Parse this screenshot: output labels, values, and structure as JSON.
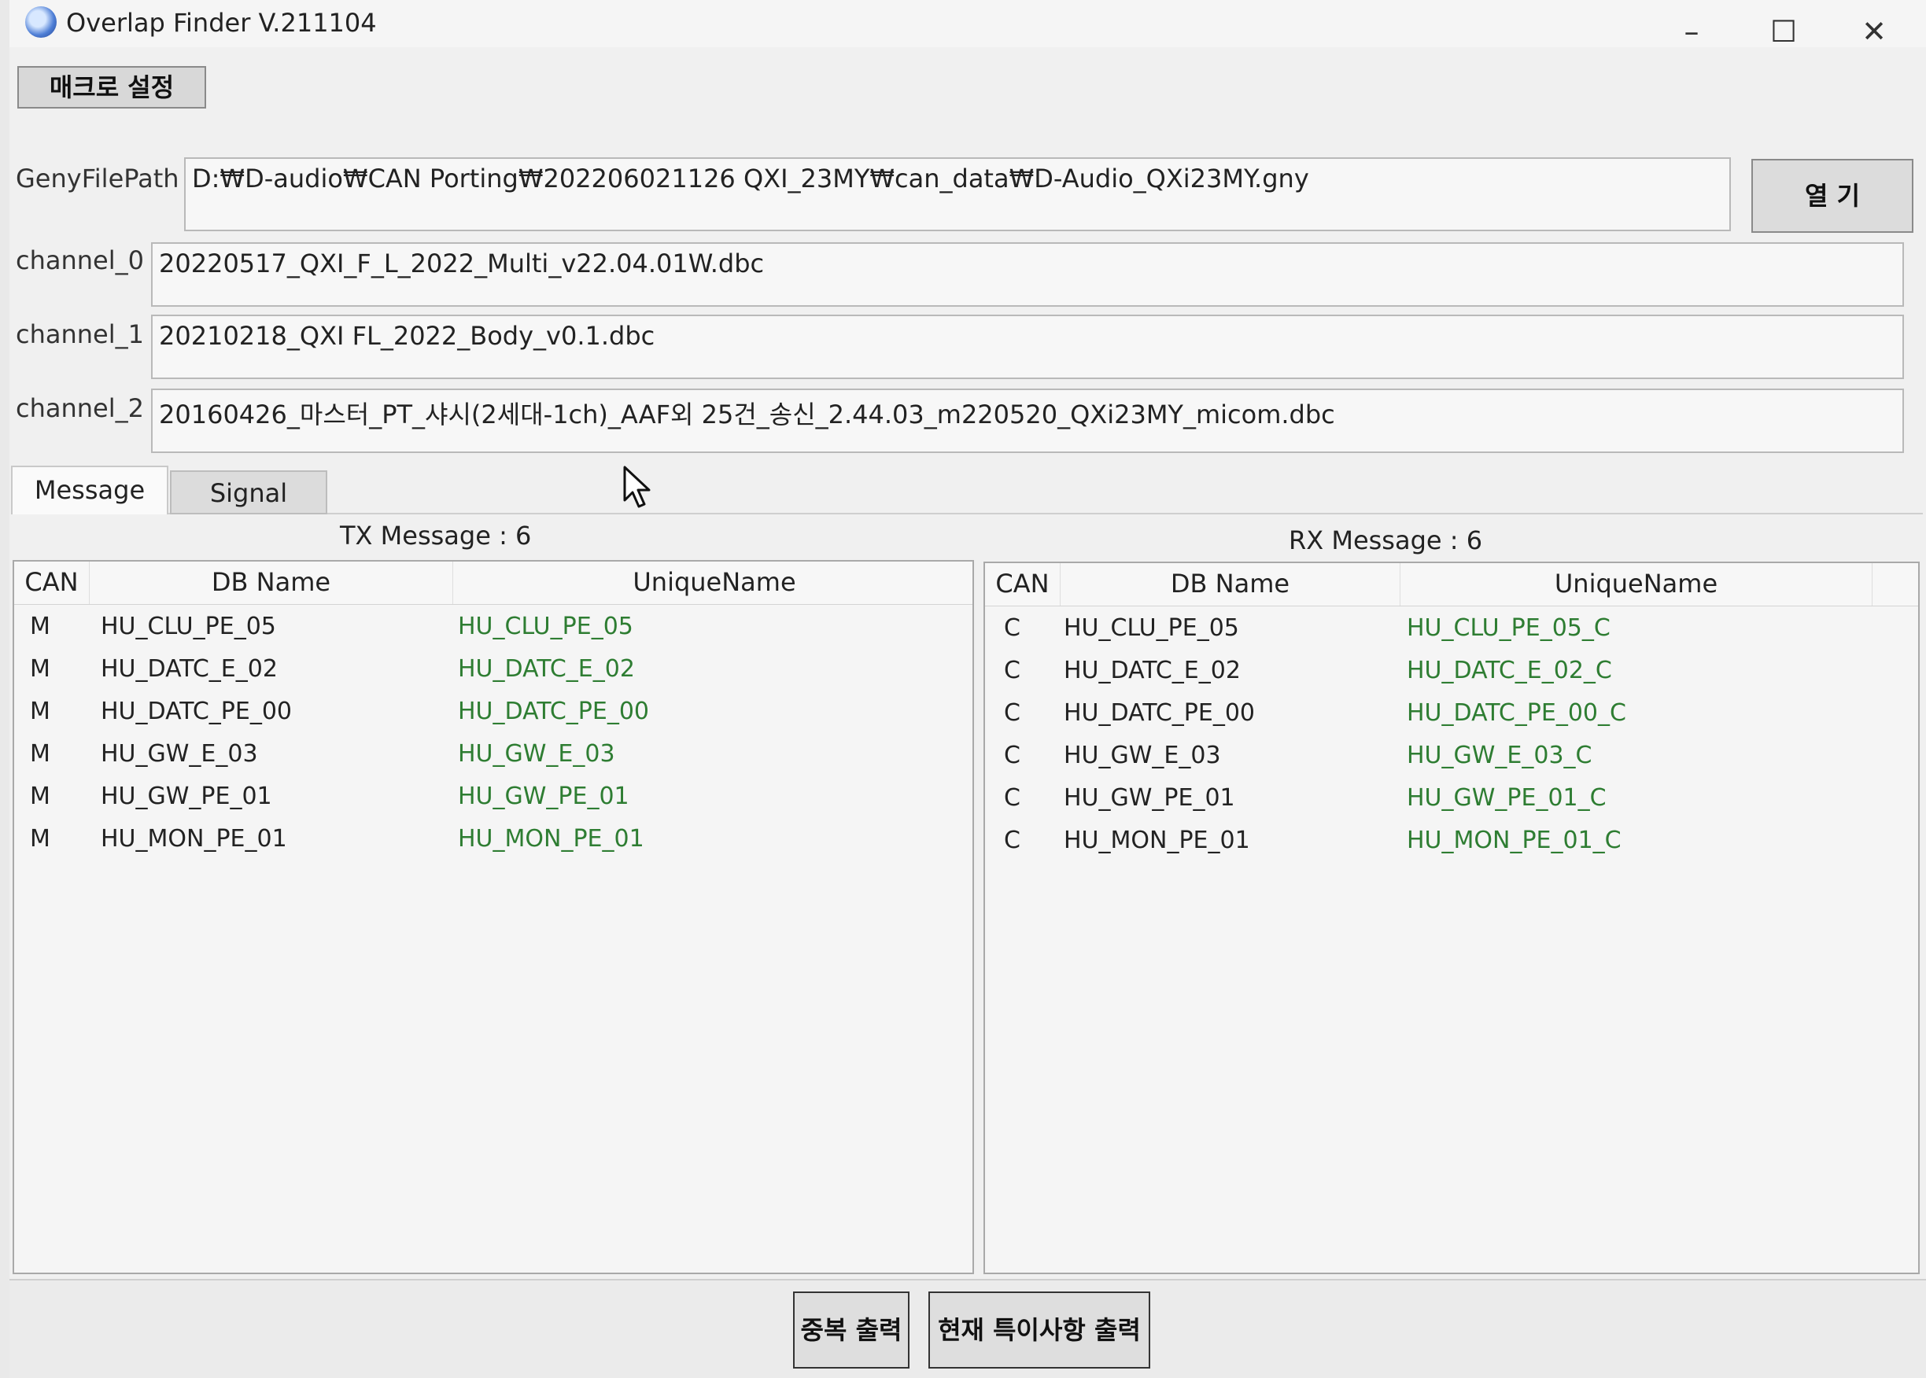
{
  "window": {
    "title": "Overlap Finder V.211104",
    "controls": {
      "minimize": "–",
      "maximize": "☐",
      "close": "✕"
    }
  },
  "toolbar": {
    "macro_label": "매크로 설정"
  },
  "geny": {
    "label": "GenyFilePath",
    "value": "D:₩D-audio₩CAN Porting₩202206021126 QXI_23MY₩can_data₩D-Audio_QXi23MY.gny",
    "open_label": "열 기"
  },
  "channels": [
    {
      "label": "channel_0",
      "value": "20220517_QXI_F_L_2022_Multi_v22.04.01W.dbc"
    },
    {
      "label": "channel_1",
      "value": "20210218_QXI FL_2022_Body_v0.1.dbc"
    },
    {
      "label": "channel_2",
      "value": "20160426_마스터_PT_샤시(2세대-1ch)_AAF외 25건_송신_2.44.03_m220520_QXi23MY_micom.dbc"
    }
  ],
  "tabs": [
    {
      "label": "Message",
      "active": true
    },
    {
      "label": "Signal",
      "active": false
    }
  ],
  "tx": {
    "count_label": "TX Message : 6",
    "columns": [
      "CAN",
      "DB Name",
      "UniqueName"
    ],
    "rows": [
      {
        "can": "M",
        "db": "HU_CLU_PE_05",
        "unique": "HU_CLU_PE_05"
      },
      {
        "can": "M",
        "db": "HU_DATC_E_02",
        "unique": "HU_DATC_E_02"
      },
      {
        "can": "M",
        "db": "HU_DATC_PE_00",
        "unique": "HU_DATC_PE_00"
      },
      {
        "can": "M",
        "db": "HU_GW_E_03",
        "unique": "HU_GW_E_03"
      },
      {
        "can": "M",
        "db": "HU_GW_PE_01",
        "unique": "HU_GW_PE_01"
      },
      {
        "can": "M",
        "db": "HU_MON_PE_01",
        "unique": "HU_MON_PE_01"
      }
    ]
  },
  "rx": {
    "count_label": "RX Message : 6",
    "columns": [
      "CAN",
      "DB Name",
      "UniqueName"
    ],
    "rows": [
      {
        "can": "C",
        "db": "HU_CLU_PE_05",
        "unique": "HU_CLU_PE_05_C"
      },
      {
        "can": "C",
        "db": "HU_DATC_E_02",
        "unique": "HU_DATC_E_02_C"
      },
      {
        "can": "C",
        "db": "HU_DATC_PE_00",
        "unique": "HU_DATC_PE_00_C"
      },
      {
        "can": "C",
        "db": "HU_GW_E_03",
        "unique": "HU_GW_E_03_C"
      },
      {
        "can": "C",
        "db": "HU_GW_PE_01",
        "unique": "HU_GW_PE_01_C"
      },
      {
        "can": "C",
        "db": "HU_MON_PE_01",
        "unique": "HU_MON_PE_01_C"
      }
    ]
  },
  "bottom": {
    "duplicate_label": "중복 출력",
    "special_label": "현재 특이사항 출력"
  },
  "colors": {
    "unique_name": "#2e7d32"
  },
  "icons": {
    "app": "overlap-finder-app-icon",
    "cursor": "mouse-pointer-icon"
  }
}
